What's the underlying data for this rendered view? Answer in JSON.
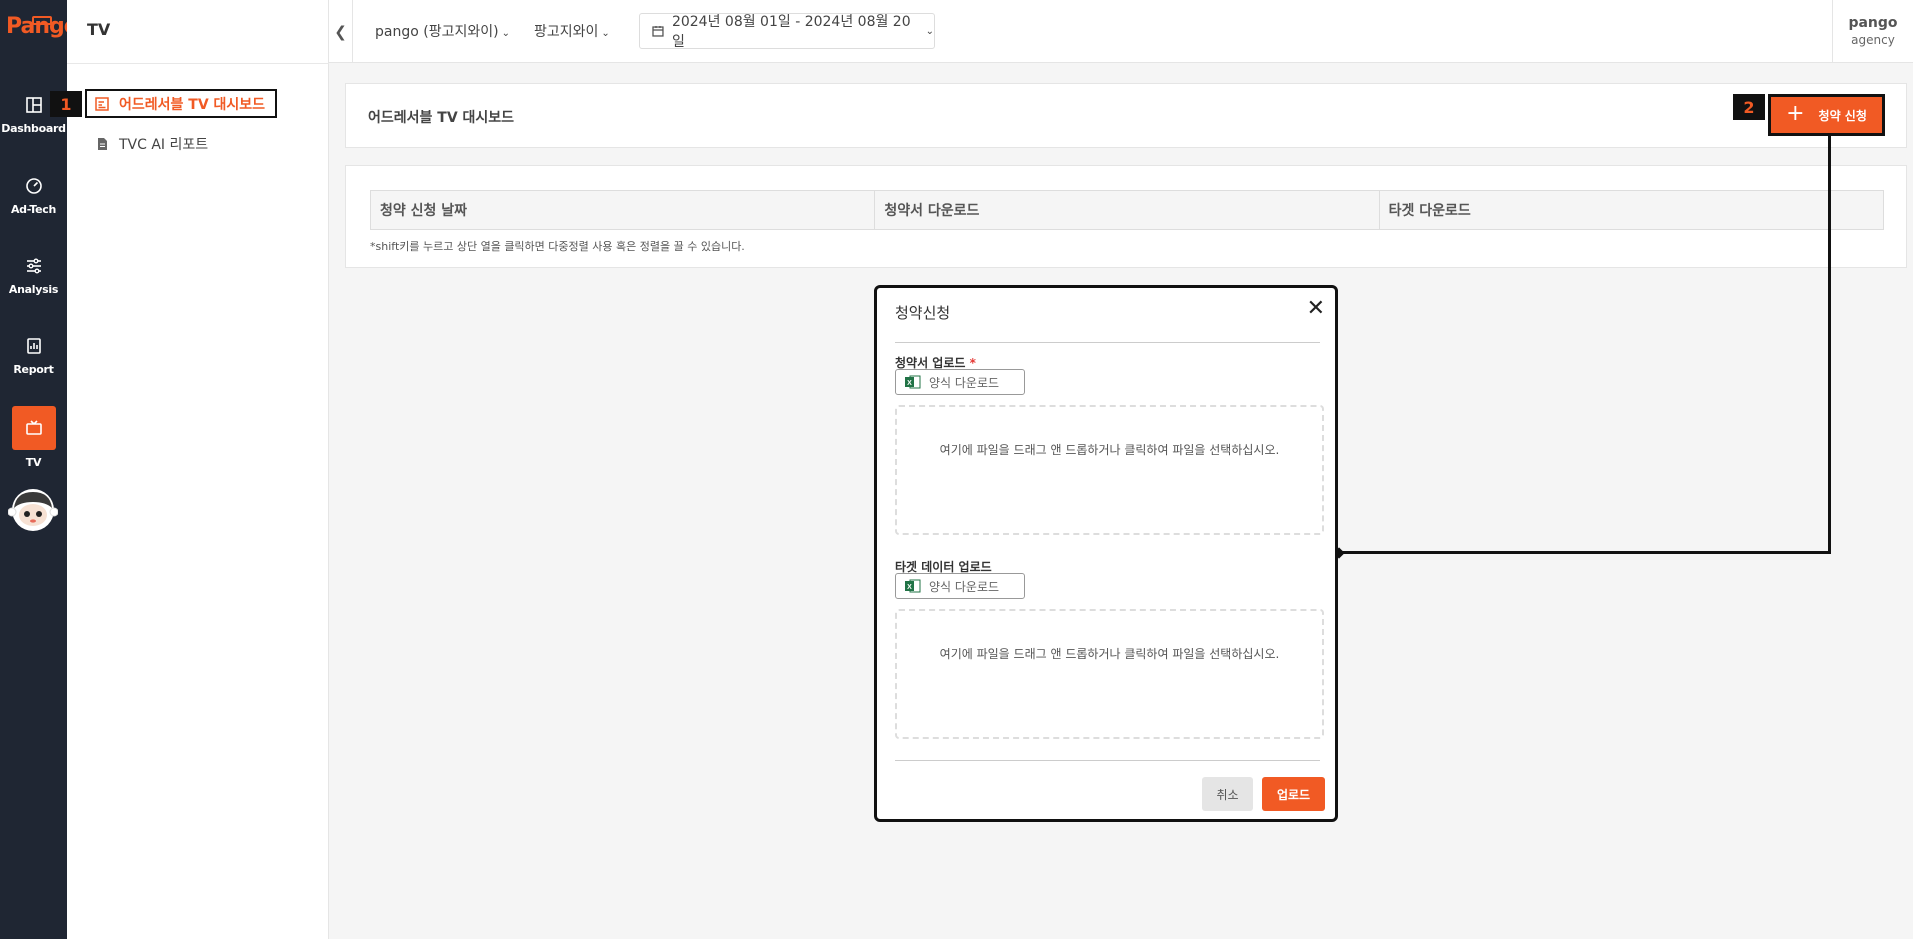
{
  "brand": {
    "logo_text": "Pango",
    "accent": "#f15a24",
    "rail_bg": "#1f2633"
  },
  "rail": {
    "items": [
      {
        "label": "Dashboard",
        "icon": "dashboard-icon"
      },
      {
        "label": "Ad-Tech",
        "icon": "gauge-icon"
      },
      {
        "label": "Analysis",
        "icon": "sliders-icon"
      },
      {
        "label": "Report",
        "icon": "report-icon"
      },
      {
        "label": "TV",
        "icon": "tv-icon",
        "active": true
      }
    ]
  },
  "submenu": {
    "title": "TV",
    "items": [
      {
        "label": "어드레서블 TV 대시보드",
        "icon": "chart-icon",
        "active": true
      },
      {
        "label": "TVC AI 리포트",
        "icon": "document-icon"
      }
    ]
  },
  "annotations": {
    "badge1": "1",
    "badge2": "2"
  },
  "topbar": {
    "account": "pango (팡고지와이)",
    "advertiser": "팡고지와이",
    "date_range": "2024년 08월 01일 - 2024년 08월 20일",
    "user_name": "pango",
    "user_role": "agency"
  },
  "header": {
    "title": "어드레서블 TV 대시보드",
    "apply_button": "청약 신청"
  },
  "table": {
    "columns": [
      "청약 신청 날짜",
      "청약서 다운로드",
      "타겟 다운로드"
    ],
    "note": "*shift키를 누르고 상단 열을 클릭하면 다중정렬 사용 혹은 정렬을 끌 수 있습니다."
  },
  "modal": {
    "title": "청약신청",
    "section1_label": "청약서 업로드",
    "required_mark": "*",
    "download_template": "양식 다운로드",
    "dropzone_text": "여기에 파일을 드래그 앤 드롭하거나 클릭하여 파일을 선택하십시오.",
    "section2_label": "타겟 데이터 업로드",
    "cancel": "취소",
    "upload": "업로드"
  }
}
